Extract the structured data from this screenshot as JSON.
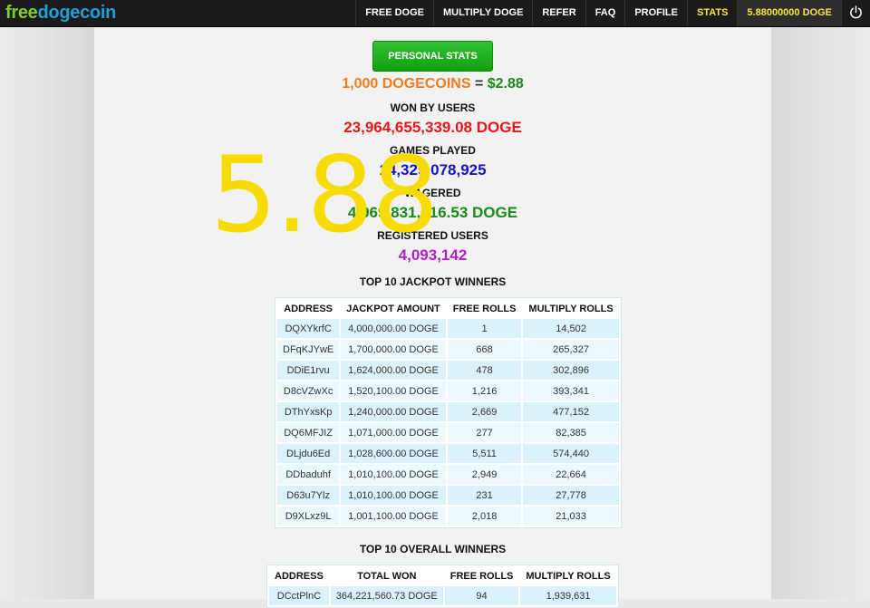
{
  "logo": {
    "part1": "free",
    "part2": "dogecoin"
  },
  "nav": {
    "items": [
      {
        "label": "FREE DOGE"
      },
      {
        "label": "MULTIPLY DOGE"
      },
      {
        "label": "REFER"
      },
      {
        "label": "FAQ"
      },
      {
        "label": "PROFILE"
      },
      {
        "label": "STATS"
      }
    ],
    "balance": "5.88000000 DOGE",
    "power_icon": "power-icon"
  },
  "stats": {
    "button_label": "PERSONAL STATS",
    "price_coins": "1,000 DOGECOINS",
    "price_eq": " = ",
    "price_usd": "$2.88",
    "won_label": "WON BY USERS",
    "won_value": "23,964,655,339.08 DOGE",
    "games_label": "GAMES PLAYED",
    "games_value": "14,329,078,925",
    "wagered_label": "WAGERED",
    "wagered_value": "4,969,831,916.53 DOGE",
    "users_label": "REGISTERED USERS",
    "users_value": "4,093,142"
  },
  "overlay_value": "5.88",
  "jackpot": {
    "title": "TOP 10 JACKPOT WINNERS",
    "headers": [
      "ADDRESS",
      "JACKPOT AMOUNT",
      "FREE ROLLS",
      "MULTIPLY ROLLS"
    ],
    "rows": [
      [
        "DQXYkrfC",
        "4,000,000.00 DOGE",
        "1",
        "14,502"
      ],
      [
        "DFqKJYwE",
        "1,700,000.00 DOGE",
        "668",
        "265,327"
      ],
      [
        "DDiE1rvu",
        "1,624,000.00 DOGE",
        "478",
        "302,896"
      ],
      [
        "D8cVZwXc",
        "1,520,100.00 DOGE",
        "1,216",
        "393,341"
      ],
      [
        "DThYxsKp",
        "1,240,000.00 DOGE",
        "2,669",
        "477,152"
      ],
      [
        "DQ6MFJIZ",
        "1,071,000.00 DOGE",
        "277",
        "82,385"
      ],
      [
        "DLjdu6Ed",
        "1,028,600.00 DOGE",
        "5,511",
        "574,440"
      ],
      [
        "DDbaduhf",
        "1,010,100.00 DOGE",
        "2,949",
        "22,664"
      ],
      [
        "D63u7Ylz",
        "1,010,100.00 DOGE",
        "231",
        "27,778"
      ],
      [
        "D9XLxz9L",
        "1,001,100.00 DOGE",
        "2,018",
        "21,033"
      ]
    ]
  },
  "overall": {
    "title": "TOP 10 OVERALL WINNERS",
    "headers": [
      "ADDRESS",
      "TOTAL WON",
      "FREE ROLLS",
      "MULTIPLY ROLLS"
    ],
    "rows": [
      [
        "DCctPlnC",
        "364,221,560.73 DOGE",
        "94",
        "1,939,631"
      ]
    ]
  }
}
